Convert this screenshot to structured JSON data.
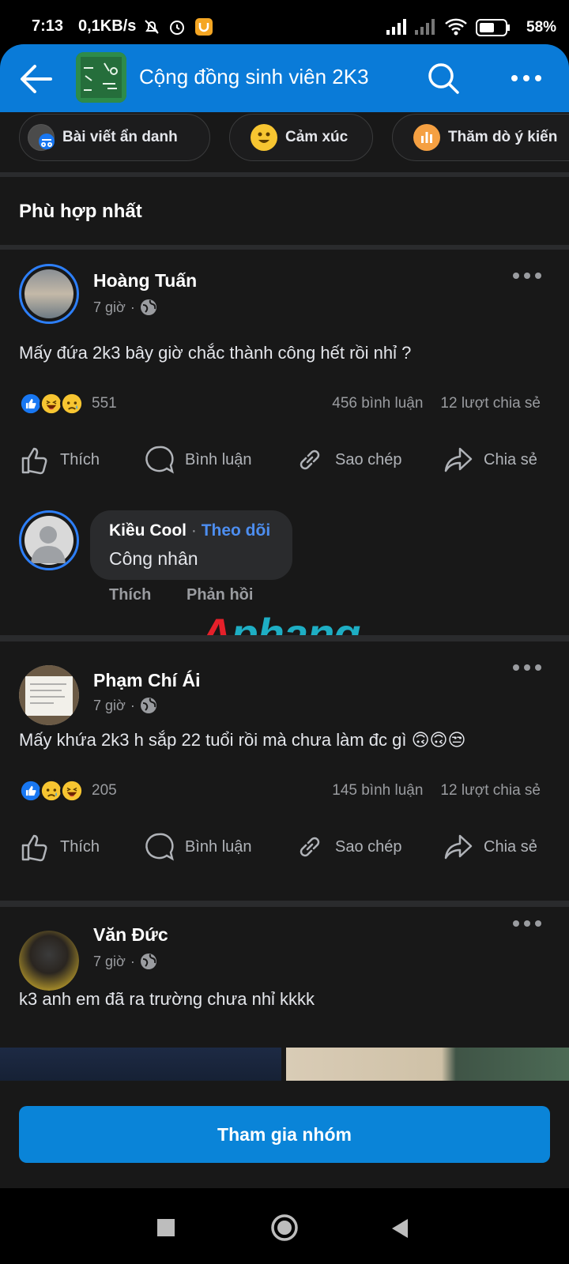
{
  "status_bar": {
    "time": "7:13",
    "speed": "0,1KB/s",
    "battery": "58%"
  },
  "header": {
    "title": "Cộng đồng sinh viên 2K3",
    "accent": "#0a7bd8"
  },
  "chips": [
    {
      "label": "Bài viết ẩn danh",
      "icon": "incognito-icon"
    },
    {
      "label": "Cảm xúc",
      "icon": "smiley-icon"
    },
    {
      "label": "Thăm dò ý kiến",
      "icon": "poll-icon"
    }
  ],
  "section": {
    "title": "Phù hợp nhất"
  },
  "posts": [
    {
      "author": "Hoàng Tuấn",
      "time": "7 giờ",
      "dot": "·",
      "text": "Mấy đứa 2k3 bây giờ chắc thành công hết rồi nhỉ ?",
      "reactions": [
        "like",
        "haha",
        "sad"
      ],
      "reaction_count": "551",
      "comments": "456 bình luận",
      "shares": "12 lượt chia sẻ"
    },
    {
      "author": "Phạm Chí Ái",
      "time": "7 giờ",
      "dot": "·",
      "text": "Mấy khứa 2k3 h sắp 22 tuổi rồi mà chưa làm đc gì 🙃🙃😒",
      "reactions": [
        "like",
        "sad",
        "haha"
      ],
      "reaction_count": "205",
      "comments": "145 bình luận",
      "shares": "12 lượt chia sẻ"
    },
    {
      "author": "Văn Đức",
      "time": "7 giờ",
      "dot": "·",
      "text": "k3 anh em đã ra trường chưa nhỉ kkkk"
    }
  ],
  "actions": {
    "like": "Thích",
    "comment": "Bình luận",
    "copy": "Sao chép",
    "share": "Chia sẻ"
  },
  "comment": {
    "author": "Kiều Cool",
    "dot": "·",
    "follow": "Theo dõi",
    "text": "Công nhân",
    "like": "Thích",
    "reply": "Phản hồi"
  },
  "watermark": {
    "part1": "A",
    "part2": "phang"
  },
  "join_button": "Tham gia nhóm"
}
